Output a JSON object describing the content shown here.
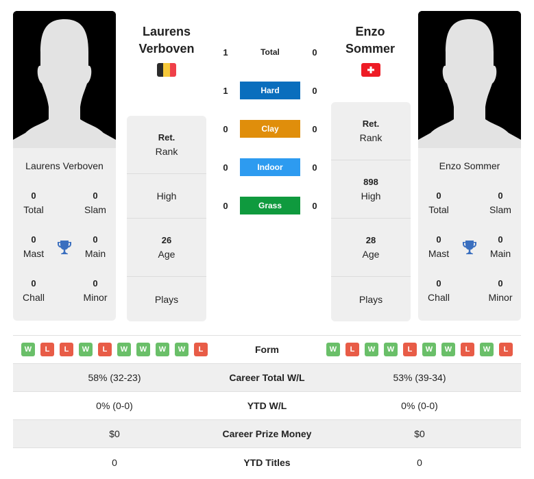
{
  "player1": {
    "name": "Laurens Verboven",
    "name_line1": "Laurens",
    "name_line2": "Verboven",
    "country": "Belgium",
    "flag_colors": [
      "#2b2b2b",
      "#f6c93b",
      "#ef4049"
    ],
    "titles": {
      "total": {
        "value": "0",
        "label": "Total"
      },
      "slam": {
        "value": "0",
        "label": "Slam"
      },
      "mast": {
        "value": "0",
        "label": "Mast"
      },
      "main": {
        "value": "0",
        "label": "Main"
      },
      "chall": {
        "value": "0",
        "label": "Chall"
      },
      "minor": {
        "value": "0",
        "label": "Minor"
      }
    },
    "info": {
      "rank": {
        "value": "Ret.",
        "label": "Rank"
      },
      "high": {
        "value": "",
        "label": "High"
      },
      "age": {
        "value": "26",
        "label": "Age"
      },
      "plays": {
        "value": "",
        "label": "Plays"
      }
    },
    "form": [
      "W",
      "L",
      "L",
      "W",
      "L",
      "W",
      "W",
      "W",
      "W",
      "L"
    ]
  },
  "player2": {
    "name": "Enzo Sommer",
    "name_line1": "Enzo",
    "name_line2": "Sommer",
    "country": "Switzerland",
    "flag_colors": [
      "#ee1c25",
      "#ffffff"
    ],
    "titles": {
      "total": {
        "value": "0",
        "label": "Total"
      },
      "slam": {
        "value": "0",
        "label": "Slam"
      },
      "mast": {
        "value": "0",
        "label": "Mast"
      },
      "main": {
        "value": "0",
        "label": "Main"
      },
      "chall": {
        "value": "0",
        "label": "Chall"
      },
      "minor": {
        "value": "0",
        "label": "Minor"
      }
    },
    "info": {
      "rank": {
        "value": "Ret.",
        "label": "Rank"
      },
      "high": {
        "value": "898",
        "label": "High"
      },
      "age": {
        "value": "28",
        "label": "Age"
      },
      "plays": {
        "value": "",
        "label": "Plays"
      }
    },
    "form": [
      "W",
      "L",
      "W",
      "W",
      "L",
      "W",
      "W",
      "L",
      "W",
      "L"
    ]
  },
  "h2h": [
    {
      "label": "Total",
      "p1": "1",
      "p2": "0",
      "color": ""
    },
    {
      "label": "Hard",
      "p1": "1",
      "p2": "0",
      "color": "#0a6ebd"
    },
    {
      "label": "Clay",
      "p1": "0",
      "p2": "0",
      "color": "#e08e0b"
    },
    {
      "label": "Indoor",
      "p1": "0",
      "p2": "0",
      "color": "#2d9bf0"
    },
    {
      "label": "Grass",
      "p1": "0",
      "p2": "0",
      "color": "#0f9a3e"
    }
  ],
  "stats": {
    "form_label": "Form",
    "rows": [
      {
        "label": "Career Total W/L",
        "p1": "58% (32-23)",
        "p2": "53% (39-34)"
      },
      {
        "label": "YTD W/L",
        "p1": "0% (0-0)",
        "p2": "0% (0-0)"
      },
      {
        "label": "Career Prize Money",
        "p1": "$0",
        "p2": "$0"
      },
      {
        "label": "YTD Titles",
        "p1": "0",
        "p2": "0"
      }
    ]
  },
  "colors": {
    "trophy": "#3a6fbf",
    "win": "#6abf69",
    "loss": "#e85c47",
    "card_bg": "#efefef"
  }
}
